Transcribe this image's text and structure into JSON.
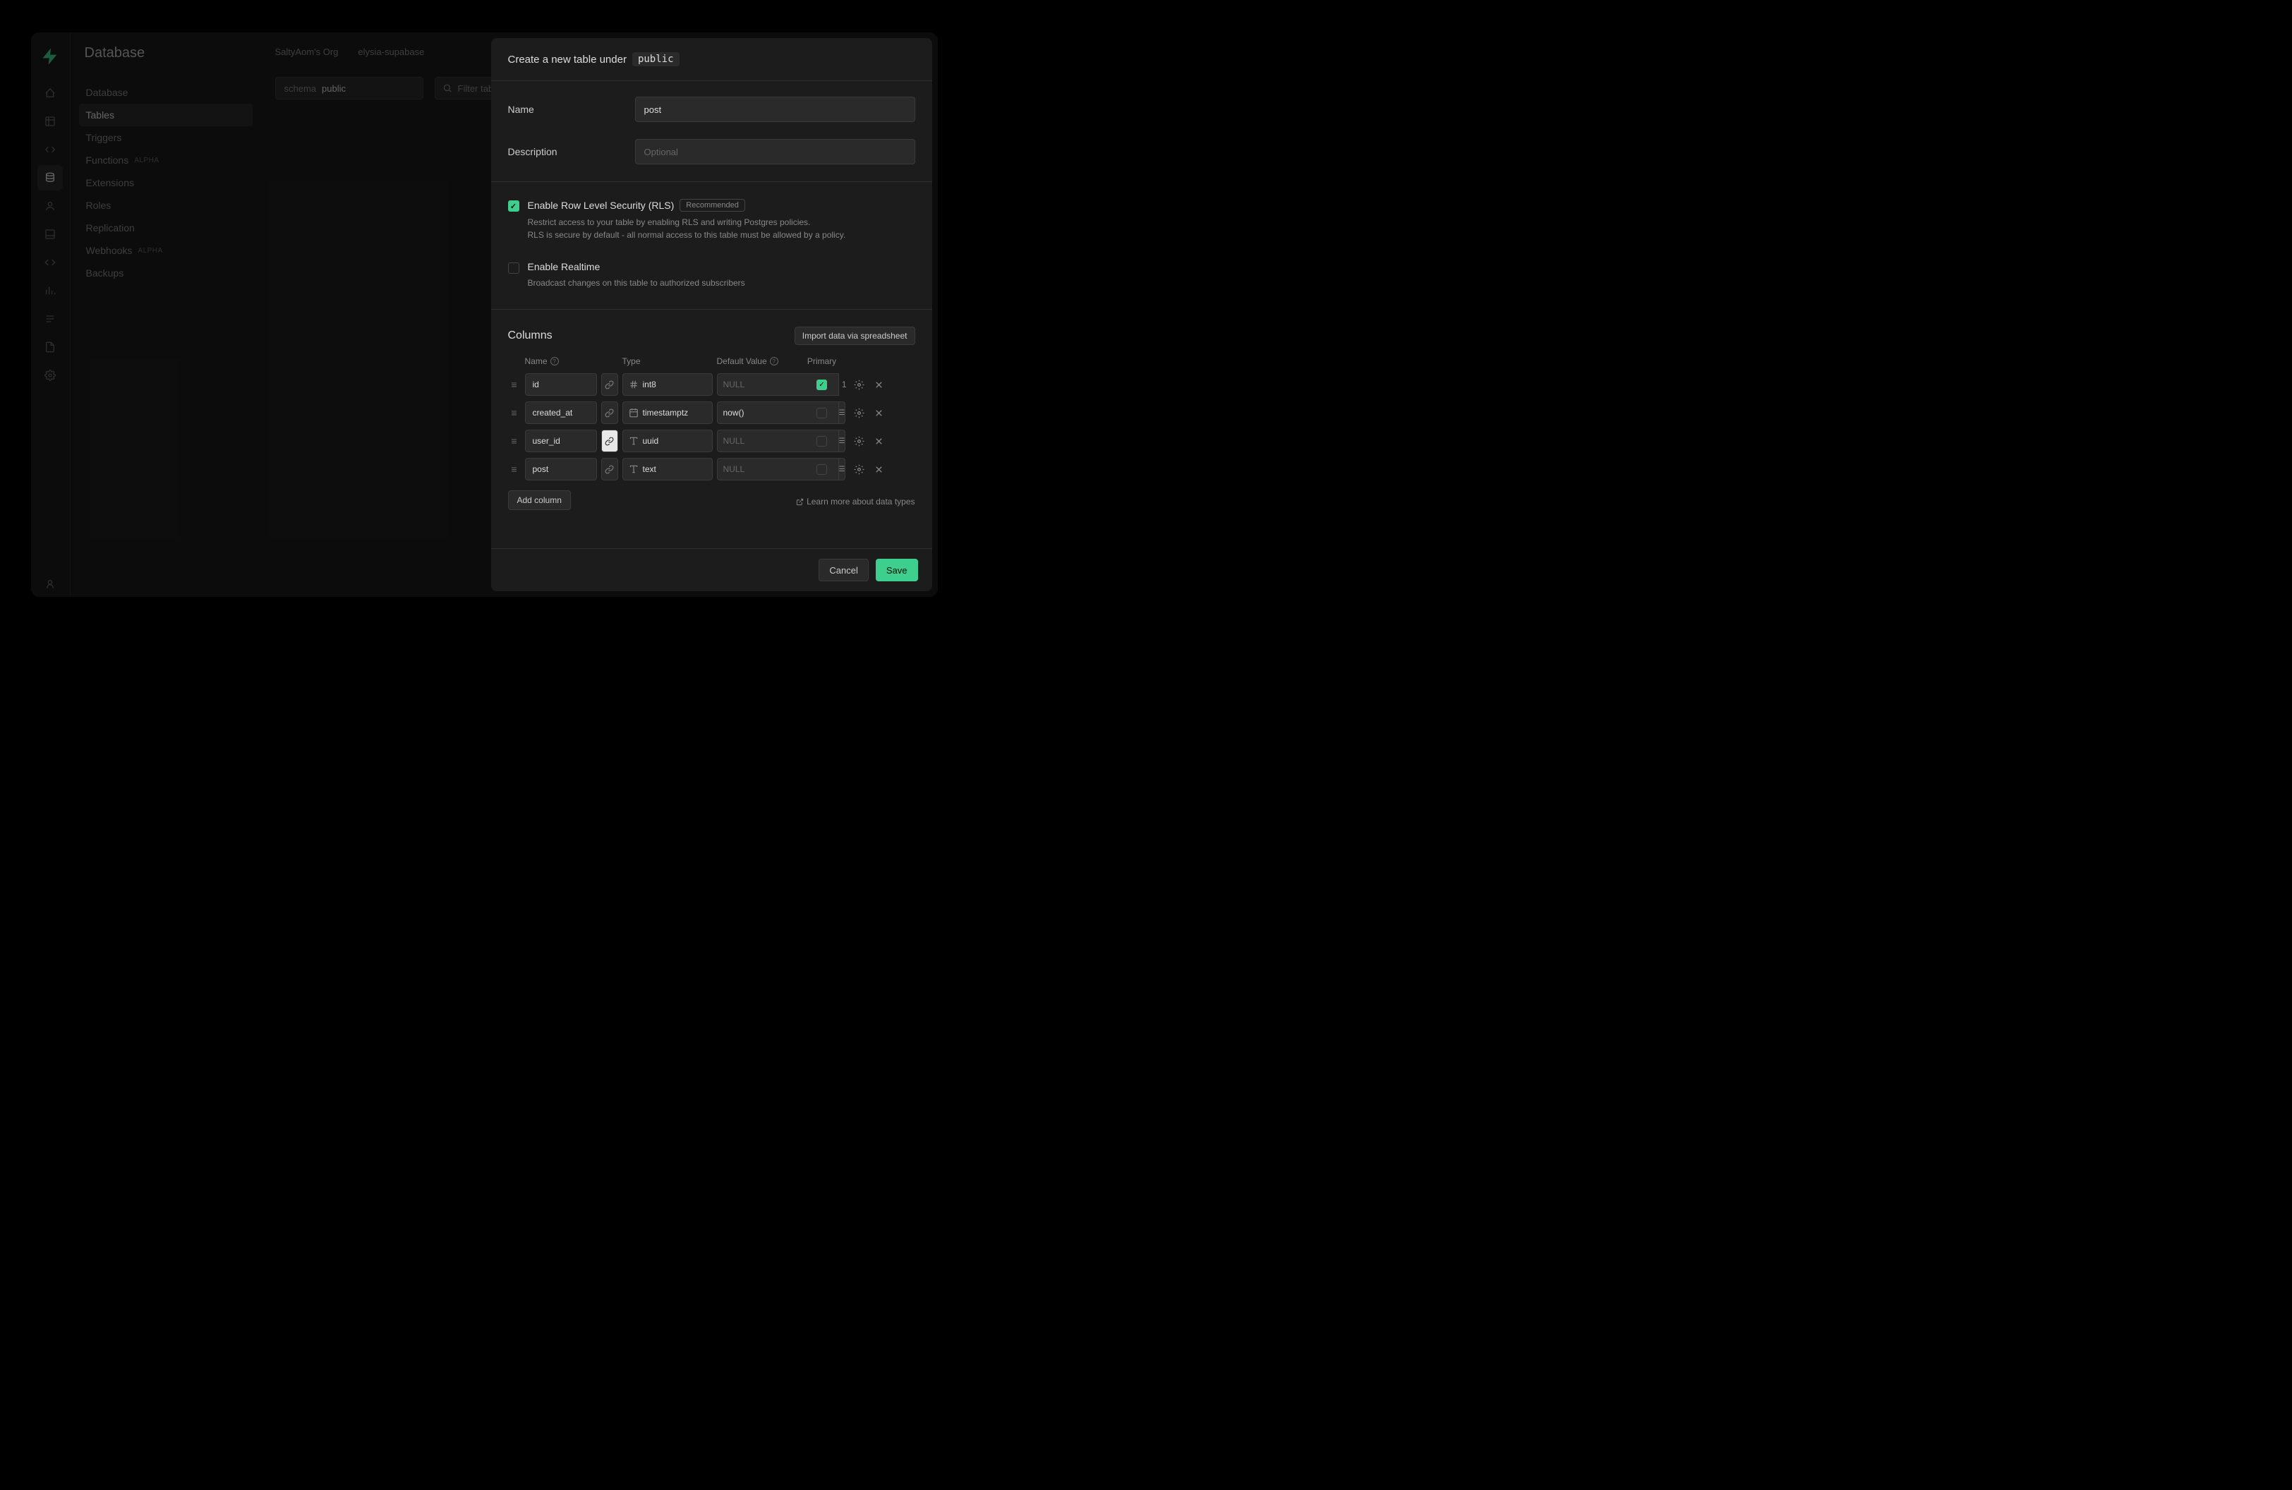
{
  "breadcrumb": {
    "org": "SaltyAom's Org",
    "project": "elysia-supabase"
  },
  "sidebar": {
    "title": "Database",
    "items": [
      {
        "label": "Database"
      },
      {
        "label": "Tables"
      },
      {
        "label": "Triggers"
      },
      {
        "label": "Functions",
        "badge": "ALPHA"
      },
      {
        "label": "Extensions"
      },
      {
        "label": "Roles"
      },
      {
        "label": "Replication"
      },
      {
        "label": "Webhooks",
        "badge": "ALPHA"
      },
      {
        "label": "Backups"
      }
    ]
  },
  "filters": {
    "schema_label": "schema",
    "schema_value": "public",
    "search_placeholder": "Filter tables"
  },
  "drawer": {
    "header_text": "Create a new table under",
    "schema": "public",
    "name_label": "Name",
    "name_value": "post",
    "desc_label": "Description",
    "desc_placeholder": "Optional",
    "rls": {
      "title": "Enable Row Level Security (RLS)",
      "recommended": "Recommended",
      "desc1": "Restrict access to your table by enabling RLS and writing Postgres policies.",
      "desc2": "RLS is secure by default - all normal access to this table must be allowed by a policy."
    },
    "realtime": {
      "title": "Enable Realtime",
      "desc": "Broadcast changes on this table to authorized subscribers"
    },
    "columns_title": "Columns",
    "import_btn": "Import data via spreadsheet",
    "headers": {
      "name": "Name",
      "type": "Type",
      "default": "Default Value",
      "primary": "Primary"
    },
    "columns": [
      {
        "name": "id",
        "type": "int8",
        "type_icon": "#",
        "default": "",
        "default_ph": "NULL",
        "default_addon": false,
        "primary": true,
        "count": "1",
        "link_active": false
      },
      {
        "name": "created_at",
        "type": "timestamptz",
        "type_icon": "cal",
        "default": "now()",
        "default_ph": "",
        "default_addon": true,
        "primary": false,
        "count": "",
        "link_active": false
      },
      {
        "name": "user_id",
        "type": "uuid",
        "type_icon": "T",
        "default": "",
        "default_ph": "NULL",
        "default_addon": true,
        "primary": false,
        "count": "",
        "link_active": true
      },
      {
        "name": "post",
        "type": "text",
        "type_icon": "T",
        "default": "",
        "default_ph": "NULL",
        "default_addon": true,
        "primary": false,
        "count": "",
        "link_active": false
      }
    ],
    "add_col": "Add column",
    "learn_link": "Learn more about data types",
    "cancel": "Cancel",
    "save": "Save"
  }
}
